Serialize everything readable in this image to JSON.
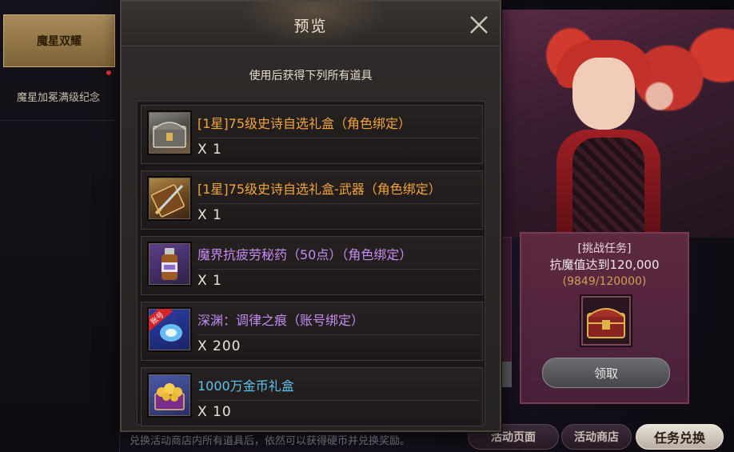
{
  "sidebar": {
    "items": [
      {
        "label": "魔星双耀",
        "active": true
      },
      {
        "label": "魔星加冕满级纪念",
        "active": false
      }
    ]
  },
  "modal": {
    "title": "预览",
    "subtitle": "使用后获得下列所有道具",
    "items": [
      {
        "name": "[1星]75级史诗自选礼盒（角色绑定）",
        "qty": "X 1",
        "rarity_color": "#f2a43c",
        "icon": "silver-chest-icon"
      },
      {
        "name": "[1星]75级史诗自选礼盒-武器（角色绑定）",
        "qty": "X 1",
        "rarity_color": "#f2a43c",
        "icon": "weapon-chest-icon"
      },
      {
        "name": "魔界抗疲劳秘药（50点）（角色绑定）",
        "qty": "X 1",
        "rarity_color": "#c48cf4",
        "icon": "potion-bottle-icon"
      },
      {
        "name": "深渊：调律之痕（账号绑定）",
        "qty": "X 200",
        "rarity_color": "#c48cf4",
        "icon": "blue-crystal-icon",
        "badge": "账号"
      },
      {
        "name": "1000万金币礼盒",
        "qty": "X 10",
        "rarity_color": "#5fc3f0",
        "icon": "gold-chest-icon"
      }
    ]
  },
  "task": {
    "title": "[挑战任务]",
    "description": "抗魔值达到120,000",
    "progress": "(9849/120000)",
    "claim_label": "领取"
  },
  "bottom_tabs": [
    {
      "label": "活动页面"
    },
    {
      "label": "活动商店"
    },
    {
      "label": "任务兑换"
    }
  ],
  "bottom_note": "兑换活动商店内所有道具后，依然可以获得硬币并兑换奖励。"
}
